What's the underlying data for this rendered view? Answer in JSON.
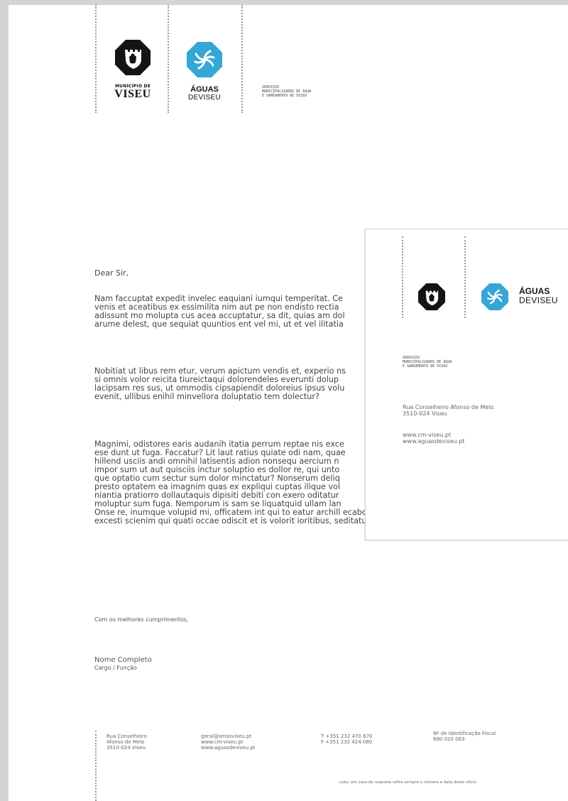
{
  "header": {
    "municipio_small": "MUNICÍPIO DE",
    "municipio_big": "VISEU",
    "aguas_title": "ÁGUAS",
    "aguas_sub": "DEVISEU",
    "smas_lines": [
      "SERVIÇOS",
      "MUNICIPALIZADOS DE ÁGUA",
      "E SANEAMENTO DE VISEU"
    ]
  },
  "letter": {
    "greeting": "Dear Sir,",
    "para1": "Nam faccuptat expedit invelec eaquiani iumqui temperitat. Ce\nvenis et aceatibus ex essimilita nim aut pe non endisto rectia\nadissunt mo molupta cus acea accuptatur, sa dit, quias am dol\narume delest, que sequiat quuntios ent vel mi, ut et vel ilitatia",
    "para2": "Nobitiat ut libus rem etur, verum apictum vendis et, experio ns\nsi omnis volor reicita tiureictaqui dolorendeles everunti dolup\nlacipsam res sus, ut ommodis cipsapiendit doloreius ipsus volu\nevenit, ullibus enihil minvellora doluptatio tem dolectur?",
    "para3": "Magnimi, odistores earis audanih itatia perrum reptae nis exce\nese dunt ut fuga. Faccatur? Lit laut ratius quiate odi nam, quae\nhillend usciis andi omnihil latisentis adion nonsequ aercium n\nimpor sum ut aut quisciis inctur soluptio es dollor re, qui unto\nque optatio cum sectur sum dolor minctatur? Nonserum deliq\npresto optatem ea imagnim quas ex expliqui cuptas ilique vol\nniantia pratiorro dollautaquis dipisiti debiti con exero oditatur\nmoluptur sum fuga. Nemporum is sam se liquatquid ullam lan\nOnse re, inumque volupid mi, officatem int qui to eatur archill ecabo. Re voloria sum quae\nexcesti scienim qui quati occae odiscit et is volorit ioritibus, seditatur alignis qui dolum simus",
    "closing": "Com os melhores cumprimentos,",
    "name": "Nome Completo",
    "role": "Cargo / Função"
  },
  "footer": {
    "address": "Rua Conselheiro\nAfonso de Melo\n3510-024 Viseu",
    "web": "geral@smasviseu.pt\nwww.cm-viseu.pt\nwww.aguasdeviseu.pt",
    "phones": "T +351 232 470 670\nF +351 232 424 080",
    "nif": "Nº de Identificação Fiscal\n680 020 063",
    "note": "nota: em caso de resposta refira sempre o número e data deste ofício"
  },
  "card": {
    "aguas_title": "ÁGUAS",
    "aguas_sub": "DEVISEU",
    "smas_lines": [
      "SERVIÇOS",
      "MUNICIPALIZADOS DE ÁGUA",
      "E SANEAMENTO DE VISEU"
    ],
    "address": "Rua Conselheiro Afonso de Melo\n3510-024 Viseu",
    "web": "www.cm-viseu.pt\nwww.aguasdeviseu.pt"
  },
  "colors": {
    "aguas_blue": "#35a6d6",
    "logo_black": "#141414"
  }
}
